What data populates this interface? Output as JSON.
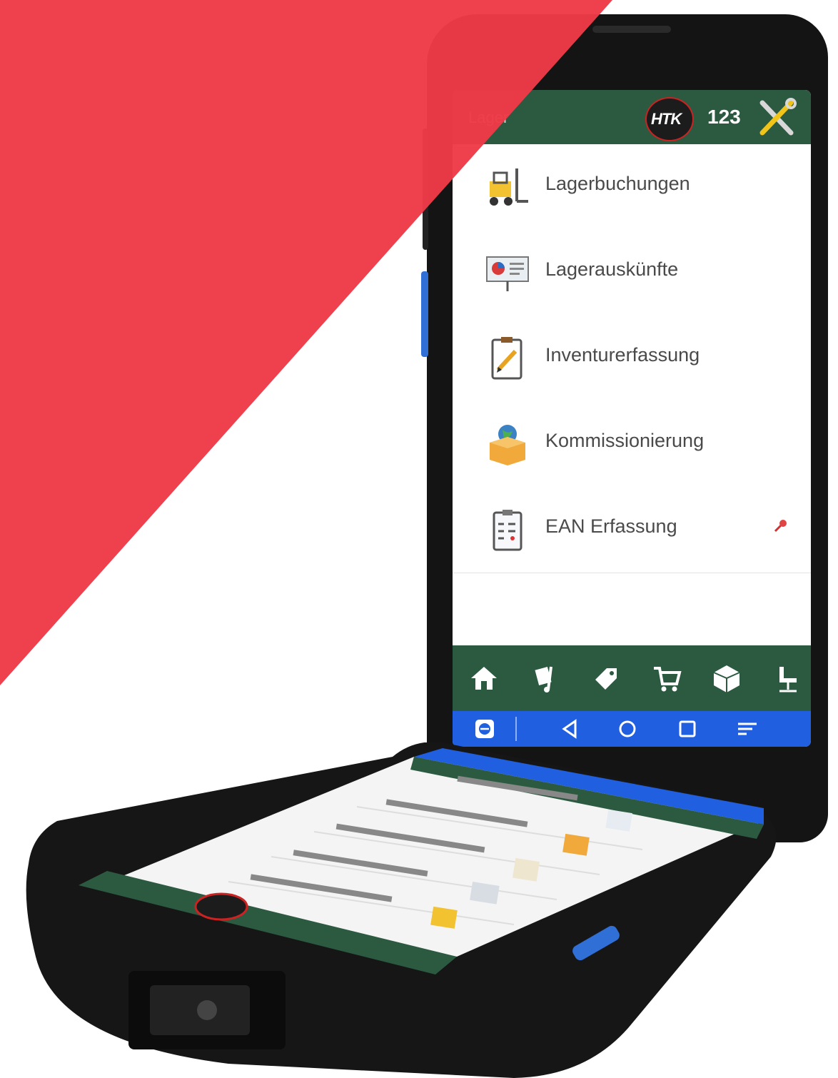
{
  "app": {
    "title": "Lager",
    "count": "123",
    "logo_text": "HTK",
    "logo_icon": "htk-logo",
    "settings_icon": "tools-icon"
  },
  "menu": {
    "items": [
      {
        "label": "Lagerbuchungen",
        "icon": "forklift-icon"
      },
      {
        "label": "Lagerauskünfte",
        "icon": "presentation-chart-icon"
      },
      {
        "label": "Inventurerfassung",
        "icon": "clipboard-pencil-icon"
      },
      {
        "label": "Kommissionierung",
        "icon": "box-globe-icon"
      },
      {
        "label": "EAN Erfassung",
        "icon": "checklist-clipboard-icon",
        "pinned": true
      }
    ]
  },
  "bottom_nav": [
    "home-icon",
    "dolly-icon",
    "tag-icon",
    "cart-icon",
    "box-icon",
    "chair-icon"
  ],
  "system_bar": [
    "remote-app-icon",
    "back-icon",
    "home-circle-icon",
    "recents-icon",
    "menu-lines-icon"
  ],
  "colors": {
    "accent_red": "#ee3a47",
    "app_green": "#2c5a41",
    "system_blue": "#1f5fe0"
  }
}
